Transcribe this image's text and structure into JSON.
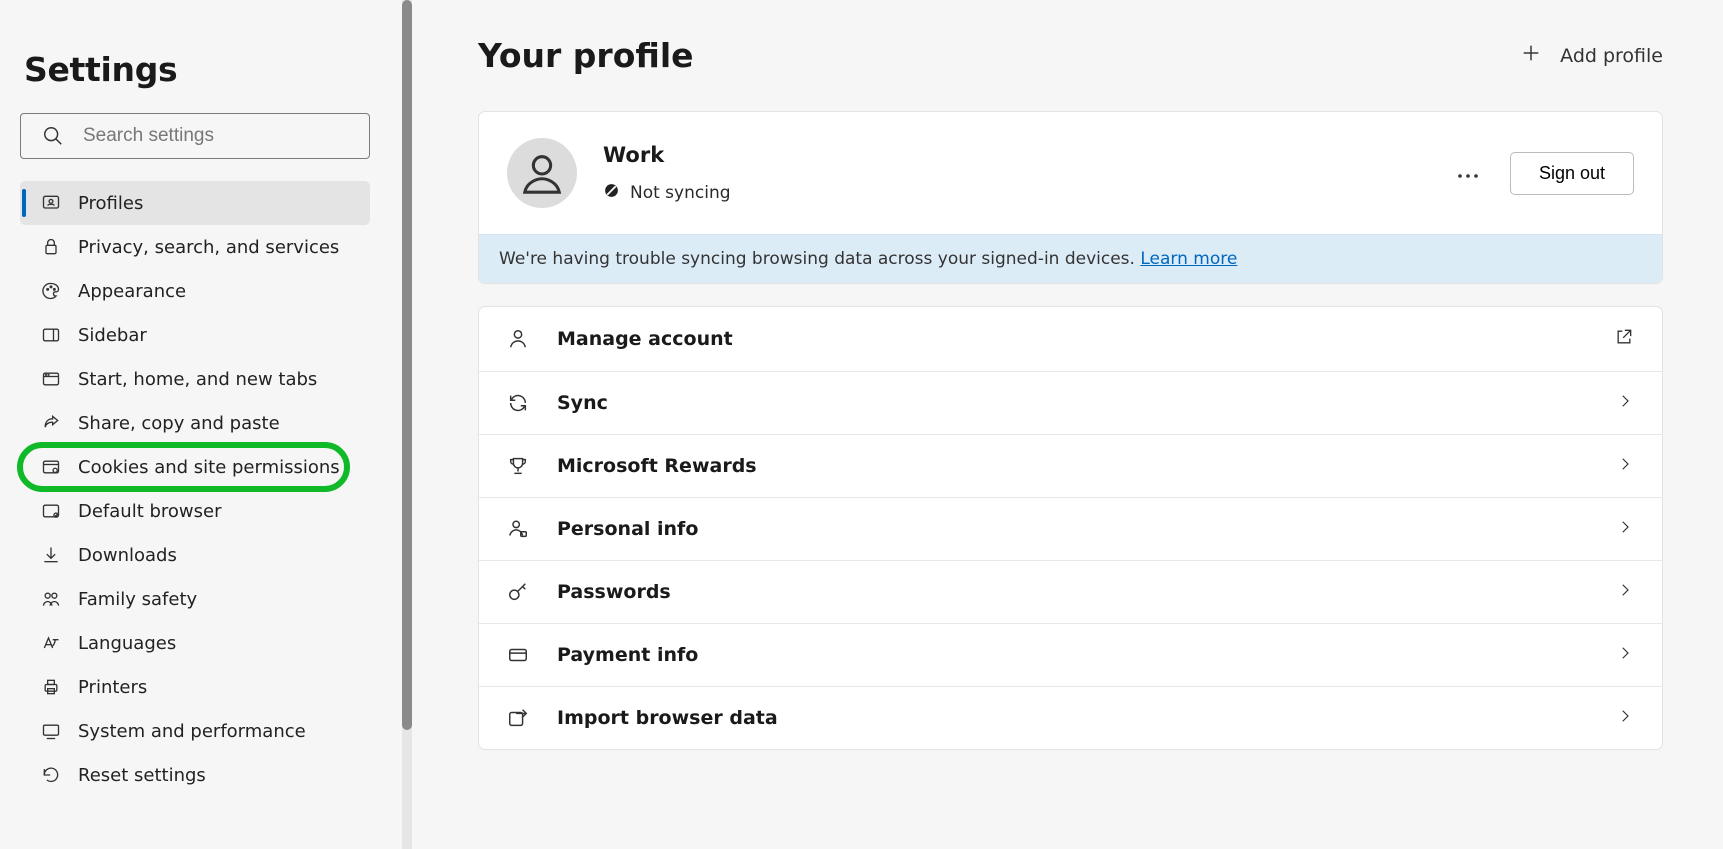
{
  "sidebar": {
    "title": "Settings",
    "search_placeholder": "Search settings",
    "items": [
      {
        "label": "Profiles",
        "icon": "profiles"
      },
      {
        "label": "Privacy, search, and services",
        "icon": "lock"
      },
      {
        "label": "Appearance",
        "icon": "appearance"
      },
      {
        "label": "Sidebar",
        "icon": "sidebar"
      },
      {
        "label": "Start, home, and new tabs",
        "icon": "start"
      },
      {
        "label": "Share, copy and paste",
        "icon": "share"
      },
      {
        "label": "Cookies and site permissions",
        "icon": "cookies"
      },
      {
        "label": "Default browser",
        "icon": "browser"
      },
      {
        "label": "Downloads",
        "icon": "download"
      },
      {
        "label": "Family safety",
        "icon": "family"
      },
      {
        "label": "Languages",
        "icon": "languages"
      },
      {
        "label": "Printers",
        "icon": "printer"
      },
      {
        "label": "System and performance",
        "icon": "system"
      },
      {
        "label": "Reset settings",
        "icon": "reset"
      }
    ],
    "selected_index": 0,
    "highlighted_index": 6
  },
  "header": {
    "title": "Your profile",
    "add_label": "Add profile"
  },
  "profile": {
    "name": "Work",
    "sync_status": "Not syncing",
    "signout_label": "Sign out",
    "notice_text": "We're having trouble syncing browsing data across your signed-in devices. ",
    "notice_link": "Learn more"
  },
  "profile_list": [
    {
      "label": "Manage account",
      "icon": "person",
      "action": "external"
    },
    {
      "label": "Sync",
      "icon": "sync",
      "action": "chevron"
    },
    {
      "label": "Microsoft Rewards",
      "icon": "trophy",
      "action": "chevron"
    },
    {
      "label": "Personal info",
      "icon": "personal",
      "action": "chevron"
    },
    {
      "label": "Passwords",
      "icon": "key",
      "action": "chevron"
    },
    {
      "label": "Payment info",
      "icon": "card",
      "action": "chevron"
    },
    {
      "label": "Import browser data",
      "icon": "import",
      "action": "chevron"
    }
  ]
}
